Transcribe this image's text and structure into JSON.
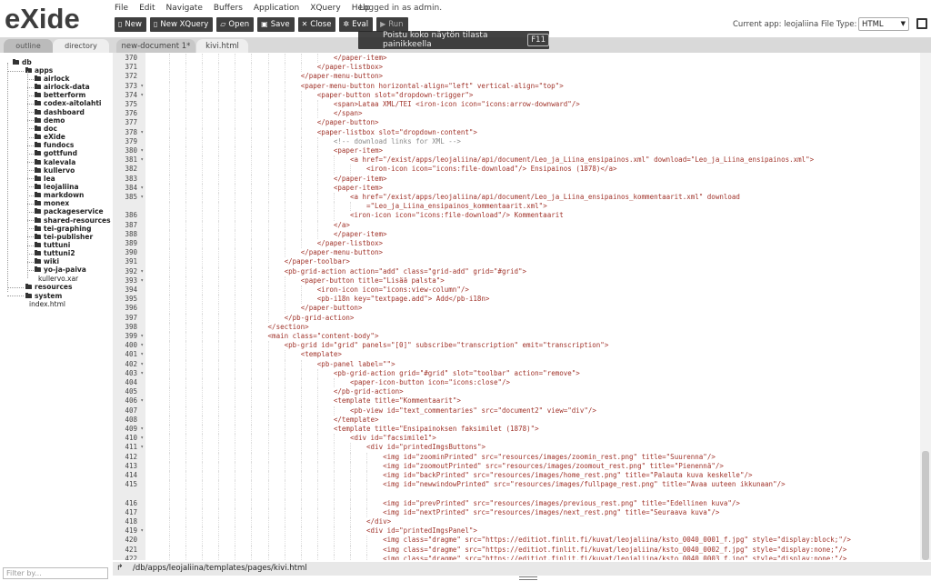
{
  "logo": {
    "text": "eXide"
  },
  "menu": [
    "File",
    "Edit",
    "Navigate",
    "Buffers",
    "Application",
    "XQuery",
    "Help"
  ],
  "login_text": "Logged in as admin.",
  "toolbar": [
    {
      "label": "New",
      "icon": "file-icon"
    },
    {
      "label": "New XQuery",
      "icon": "file-code-icon"
    },
    {
      "label": "Open",
      "icon": "folder-open-icon"
    },
    {
      "label": "Save",
      "icon": "save-icon"
    },
    {
      "label": "Close",
      "icon": "close-icon"
    },
    {
      "label": "Eval",
      "icon": "gears-icon"
    },
    {
      "label": "Run",
      "icon": "play-icon"
    }
  ],
  "current_app": "Current app: leojaliina",
  "file_type": {
    "label": "File Type:",
    "value": "HTML"
  },
  "toast": {
    "text": "Poistu koko näytön tilasta painikkeella",
    "key": "F11"
  },
  "left_tabs": {
    "outline": "outline",
    "directory": "directory"
  },
  "editor_tabs": [
    "new-document 1*",
    "kivi.html"
  ],
  "tree": {
    "db": "db",
    "apps": "apps",
    "app_items": [
      "airlock",
      "airlock-data",
      "betterform",
      "codex-aitolahti",
      "dashboard",
      "demo",
      "doc",
      "eXide",
      "fundocs",
      "gottfund",
      "kalevala",
      "kullervo",
      "lea",
      "leojaliina",
      "markdown",
      "monex",
      "packageservice",
      "shared-resources",
      "tei-graphing",
      "tei-publisher",
      "tuttuni",
      "tuttuni2",
      "wiki",
      "yo-ja-paiva"
    ],
    "kullervo_xar": "kullervo.xar",
    "resources": "resources",
    "system": "system",
    "index": "index.html"
  },
  "filter_placeholder": "Filter by...",
  "status_path": "/db/apps/leojaliina/templates/pages/kivi.html",
  "code_lines": [
    {
      "n": "370",
      "fold": false,
      "indent": 44,
      "text": "</paper-item>"
    },
    {
      "n": "371",
      "fold": false,
      "indent": 40,
      "text": "</paper-listbox>"
    },
    {
      "n": "372",
      "fold": false,
      "indent": 36,
      "text": "</paper-menu-button>"
    },
    {
      "n": "373",
      "fold": true,
      "indent": 36,
      "text": "<paper-menu-button horizontal-align=\"left\" vertical-align=\"top\">"
    },
    {
      "n": "374",
      "fold": true,
      "indent": 40,
      "text": "<paper-button slot=\"dropdown-trigger\">"
    },
    {
      "n": "375",
      "fold": false,
      "indent": 44,
      "text": "<span>Lataa XML/TEI <iron-icon icon=\"icons:arrow-downward\"/>"
    },
    {
      "n": "376",
      "fold": false,
      "indent": 44,
      "text": "</span>"
    },
    {
      "n": "377",
      "fold": false,
      "indent": 40,
      "text": "</paper-button>"
    },
    {
      "n": "378",
      "fold": true,
      "indent": 40,
      "text": "<paper-listbox slot=\"dropdown-content\">"
    },
    {
      "n": "379",
      "fold": false,
      "indent": 44,
      "text": "<!-- download links for XML -->"
    },
    {
      "n": "380",
      "fold": true,
      "indent": 44,
      "text": "<paper-item>"
    },
    {
      "n": "381",
      "fold": true,
      "indent": 48,
      "text": "<a href=\"/exist/apps/leojaliina/api/document/Leo_ja_Liina_ensipainos.xml\" download=\"Leo_ja_Liina_ensipainos.xml\">"
    },
    {
      "n": "382",
      "fold": false,
      "indent": 52,
      "text": "<iron-icon icon=\"icons:file-download\"/> Ensipainos (1878)</a>"
    },
    {
      "n": "383",
      "fold": false,
      "indent": 44,
      "text": "</paper-item>"
    },
    {
      "n": "384",
      "fold": true,
      "indent": 44,
      "text": "<paper-item>"
    },
    {
      "n": "385",
      "fold": true,
      "indent": 48,
      "text": "<a href=\"/exist/apps/leojaliina/api/document/Leo_ja_Liina_ensipainos_kommentaarit.xml\" download"
    },
    {
      "n": "",
      "fold": false,
      "indent": 52,
      "text": "=\"Leo_ja_Liina_ensipainos_kommentaarit.xml\">"
    },
    {
      "n": "386",
      "fold": false,
      "indent": 48,
      "text": "<iron-icon icon=\"icons:file-download\"/> Kommentaarit"
    },
    {
      "n": "387",
      "fold": false,
      "indent": 44,
      "text": "</a>"
    },
    {
      "n": "388",
      "fold": false,
      "indent": 44,
      "text": "</paper-item>"
    },
    {
      "n": "389",
      "fold": false,
      "indent": 40,
      "text": "</paper-listbox>"
    },
    {
      "n": "390",
      "fold": false,
      "indent": 36,
      "text": "</paper-menu-button>"
    },
    {
      "n": "391",
      "fold": false,
      "indent": 32,
      "text": "</paper-toolbar>"
    },
    {
      "n": "392",
      "fold": true,
      "indent": 32,
      "text": "<pb-grid-action action=\"add\" class=\"grid-add\" grid=\"#grid\">"
    },
    {
      "n": "393",
      "fold": true,
      "indent": 36,
      "text": "<paper-button title=\"Lisää palsta\">"
    },
    {
      "n": "394",
      "fold": false,
      "indent": 40,
      "text": "<iron-icon icon=\"icons:view-column\"/>"
    },
    {
      "n": "395",
      "fold": false,
      "indent": 40,
      "text": "<pb-i18n key=\"textpage.add\"> Add</pb-i18n>"
    },
    {
      "n": "396",
      "fold": false,
      "indent": 36,
      "text": "</paper-button>"
    },
    {
      "n": "397",
      "fold": false,
      "indent": 32,
      "text": "</pb-grid-action>"
    },
    {
      "n": "398",
      "fold": false,
      "indent": 28,
      "text": "</section>"
    },
    {
      "n": "399",
      "fold": true,
      "indent": 28,
      "text": "<main class=\"content-body\">"
    },
    {
      "n": "400",
      "fold": true,
      "indent": 32,
      "text": "<pb-grid id=\"grid\" panels=\"[0]\" subscribe=\"transcription\" emit=\"transcription\">"
    },
    {
      "n": "401",
      "fold": true,
      "indent": 36,
      "text": "<template>"
    },
    {
      "n": "402",
      "fold": true,
      "indent": 40,
      "text": "<pb-panel label=\"\">"
    },
    {
      "n": "403",
      "fold": true,
      "indent": 44,
      "text": "<pb-grid-action grid=\"#grid\" slot=\"toolbar\" action=\"remove\">"
    },
    {
      "n": "404",
      "fold": false,
      "indent": 48,
      "text": "<paper-icon-button icon=\"icons:close\"/>"
    },
    {
      "n": "405",
      "fold": false,
      "indent": 44,
      "text": "</pb-grid-action>"
    },
    {
      "n": "406",
      "fold": true,
      "indent": 44,
      "text": "<template title=\"Kommentaarit\">"
    },
    {
      "n": "407",
      "fold": false,
      "indent": 48,
      "text": "<pb-view id=\"text_commentaries\" src=\"document2\" view=\"div\"/>"
    },
    {
      "n": "408",
      "fold": false,
      "indent": 44,
      "text": "</template>"
    },
    {
      "n": "409",
      "fold": true,
      "indent": 44,
      "text": "<template title=\"Ensipainoksen faksimilet (1878)\">"
    },
    {
      "n": "410",
      "fold": true,
      "indent": 48,
      "text": "<div id=\"facsimile1\">"
    },
    {
      "n": "411",
      "fold": true,
      "indent": 52,
      "text": "<div id=\"printedImgsButtons\">"
    },
    {
      "n": "412",
      "fold": false,
      "indent": 56,
      "text": "<img id=\"zoominPrinted\" src=\"resources/images/zoomin_rest.png\" title=\"Suurenna\"/>"
    },
    {
      "n": "413",
      "fold": false,
      "indent": 56,
      "text": "<img id=\"zoomoutPrinted\" src=\"resources/images/zoomout_rest.png\" title=\"Pienennä\"/>"
    },
    {
      "n": "414",
      "fold": false,
      "indent": 56,
      "text": "<img id=\"backPrinted\" src=\"resources/images/home_rest.png\" title=\"Palauta kuva keskelle\"/>"
    },
    {
      "n": "415",
      "fold": false,
      "indent": 56,
      "text": "<img id=\"newwindowPrinted\" src=\"resources/images/fullpage_rest.png\" title=\"Avaa uuteen ikkunaan\"/>"
    },
    {
      "n": "",
      "fold": false,
      "indent": 56,
      "text": ""
    },
    {
      "n": "416",
      "fold": false,
      "indent": 56,
      "text": "<img id=\"prevPrinted\" src=\"resources/images/previous_rest.png\" title=\"Edellinen kuva\"/>"
    },
    {
      "n": "417",
      "fold": false,
      "indent": 56,
      "text": "<img id=\"nextPrinted\" src=\"resources/images/next_rest.png\" title=\"Seuraava kuva\"/>"
    },
    {
      "n": "418",
      "fold": false,
      "indent": 52,
      "text": "</div>"
    },
    {
      "n": "419",
      "fold": true,
      "indent": 52,
      "text": "<div id=\"printedImgsPanel\">"
    },
    {
      "n": "420",
      "fold": false,
      "indent": 56,
      "text": "<img class=\"dragme\" src=\"https://editiot.finlit.fi/kuvat/leojaliina/ksto_0040_0001_f.jpg\" style=\"display:block;\"/>"
    },
    {
      "n": "421",
      "fold": false,
      "indent": 56,
      "text": "<img class=\"dragme\" src=\"https://editiot.finlit.fi/kuvat/leojaliina/ksto_0040_0002_f.jpg\" style=\"display:none;\"/>"
    },
    {
      "n": "422",
      "fold": false,
      "indent": 56,
      "text": "<img class=\"dragme\" src=\"https://editiot.finlit.fi/kuvat/leojaliina/ksto_0040_0003_f.jpg\" style=\"display:none;\"/>"
    },
    {
      "n": "423",
      "fold": false,
      "indent": 56,
      "text": "<img class=\"dragme\" src=\"https://editiot.finlit.fi/kuvat/leojaliina/ksto_0040_0004_f.jpg\" style=\"display:none;\"/>"
    },
    {
      "n": "424",
      "fold": false,
      "indent": 56,
      "text": "<img class=\"dragme\" src=\"https://editiot.finlit.fi/kuvat/leojaliina/ksto_0040_0005_f.jpg\" style=\"display:none;\"/>"
    }
  ]
}
